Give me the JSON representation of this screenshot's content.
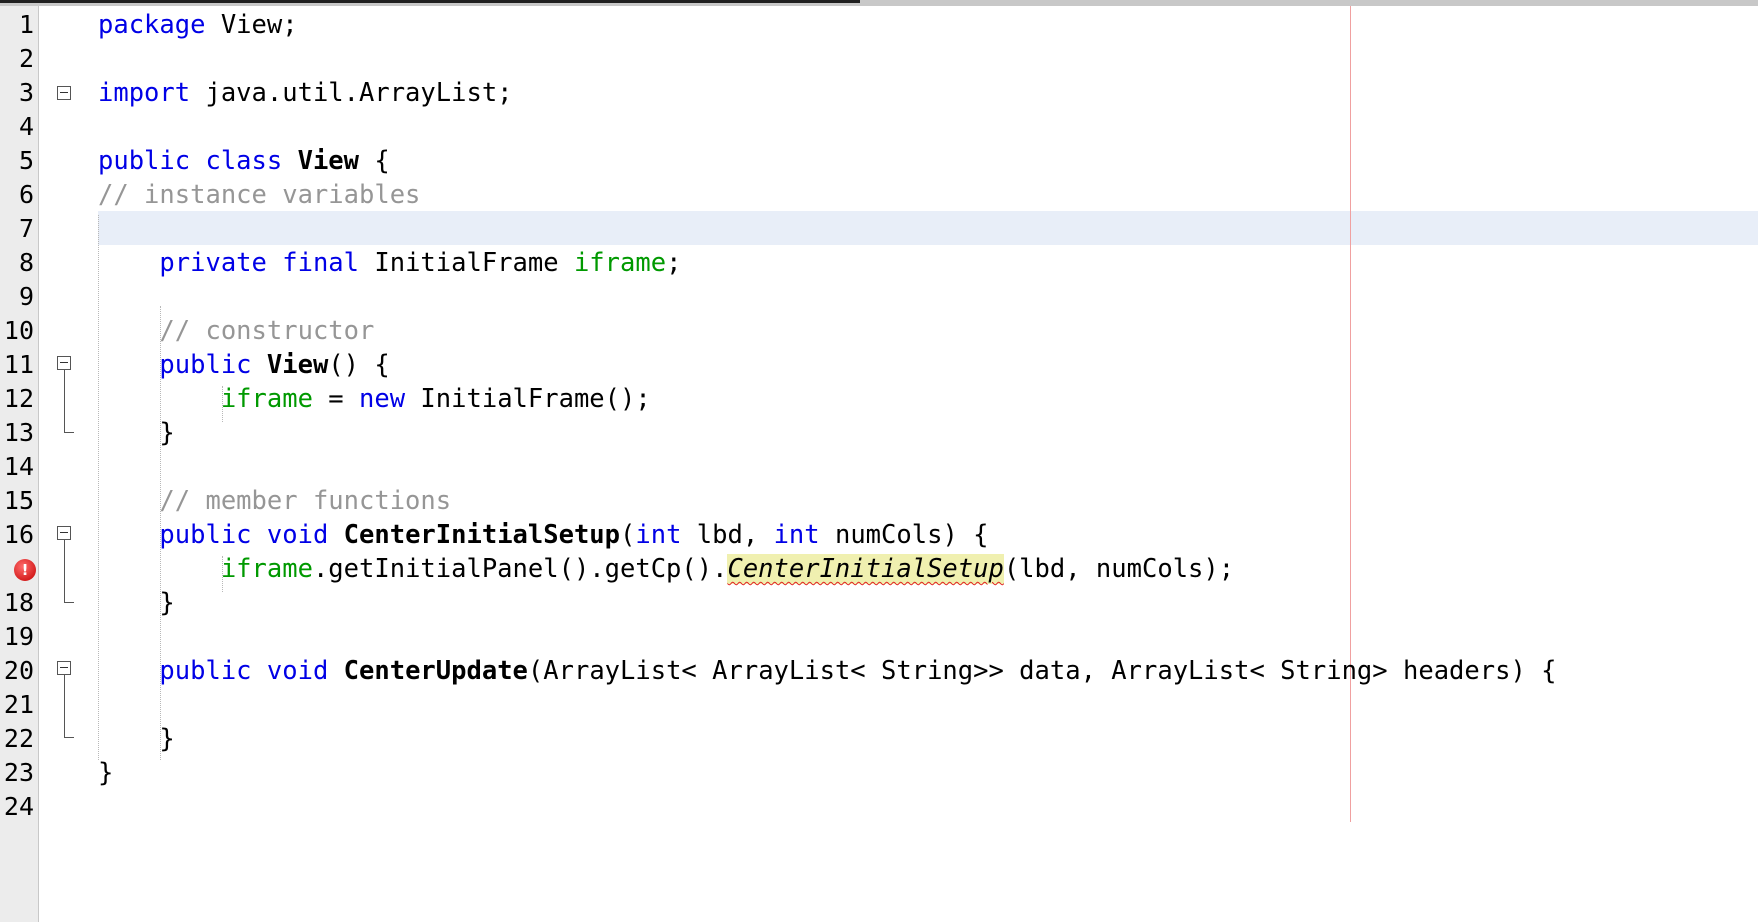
{
  "editor": {
    "line_numbers": [
      "1",
      "2",
      "3",
      "4",
      "5",
      "6",
      "7",
      "8",
      "9",
      "10",
      "11",
      "12",
      "13",
      "14",
      "15",
      "16",
      "17",
      "18",
      "19",
      "20",
      "21",
      "22",
      "23",
      "24"
    ],
    "error_marker_glyph": "!",
    "error_line": 17,
    "code": {
      "l1": [
        "package",
        " View;"
      ],
      "l3": [
        "import",
        " java.util.ArrayList;"
      ],
      "l5": [
        "public class",
        " ",
        "View",
        " {"
      ],
      "l6": [
        "// instance variables"
      ],
      "l8": [
        "    ",
        "private final",
        " InitialFrame ",
        "iframe",
        ";"
      ],
      "l10": [
        "    ",
        "// constructor"
      ],
      "l11": [
        "    ",
        "public",
        " ",
        "View",
        "() {"
      ],
      "l12": [
        "        ",
        "iframe",
        " = ",
        "new",
        " InitialFrame();"
      ],
      "l13": [
        "    }"
      ],
      "l15": [
        "    ",
        "// member functions"
      ],
      "l16": [
        "    ",
        "public void",
        " ",
        "CenterInitialSetup",
        "(",
        "int",
        " lbd, ",
        "int",
        " numCols) {"
      ],
      "l17": [
        "        ",
        "iframe",
        ".getInitialPanel().getCp().",
        "CenterInitialSetup",
        "(lbd, numCols);"
      ],
      "l18": [
        "    }"
      ],
      "l20": [
        "    ",
        "public void",
        " ",
        "CenterUpdate",
        "(ArrayList< ArrayList< String>> data, ArrayList< String> headers) {"
      ],
      "l22": [
        "    }"
      ],
      "l23": [
        "}"
      ]
    }
  },
  "colors": {
    "keyword": "#0000e6",
    "field": "#009900",
    "comment": "#969696",
    "error": "#c40000",
    "current_line": "#e8eef8",
    "error_highlight": "#f0f0b0"
  },
  "icons": {
    "fold": "collapse-box-icon",
    "error": "error-badge-icon"
  }
}
